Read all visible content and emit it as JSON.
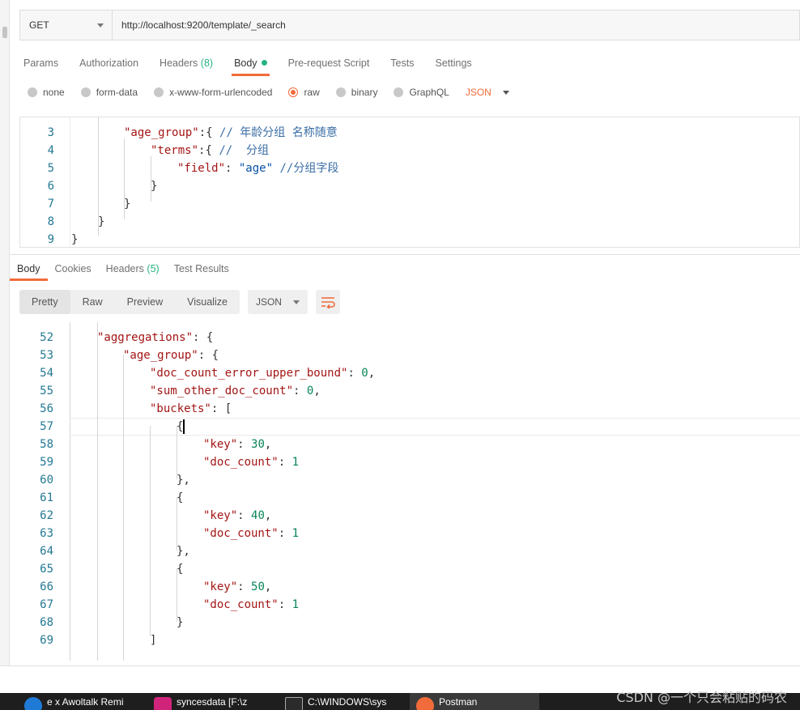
{
  "request": {
    "method": "GET",
    "url": "http://localhost:9200/template/_search"
  },
  "request_tabs": {
    "params": "Params",
    "authorization": "Authorization",
    "headers": "Headers",
    "headers_count": "(8)",
    "body": "Body",
    "pre_request": "Pre-request Script",
    "tests": "Tests",
    "settings": "Settings"
  },
  "body_types": {
    "none": "none",
    "form_data": "form-data",
    "urlencoded": "x-www-form-urlencoded",
    "raw": "raw",
    "binary": "binary",
    "graphql": "GraphQL",
    "format": "JSON"
  },
  "request_code": {
    "ln3": "3",
    "ln4": "4",
    "ln5": "5",
    "ln6": "6",
    "ln7": "7",
    "ln8": "8",
    "ln9": "9",
    "l3_key": "\"age_group\"",
    "l3_rest": ":{ ",
    "l3_comment": "// 年龄分组 名称随意",
    "l4_key": "\"terms\"",
    "l4_rest": ":{ ",
    "l4_comment": "//  分组",
    "l5_key": "\"field\"",
    "l5_colon": ": ",
    "l5_val": "\"age\"",
    "l5_comment": " //分组字段",
    "brace_close": "}"
  },
  "response_tabs": {
    "body": "Body",
    "cookies": "Cookies",
    "headers": "Headers",
    "headers_count": "(5)",
    "test_results": "Test Results"
  },
  "response_toolbar": {
    "pretty": "Pretty",
    "raw": "Raw",
    "preview": "Preview",
    "visualize": "Visualize",
    "format": "JSON"
  },
  "response_code": {
    "ln52": "52",
    "ln53": "53",
    "ln54": "54",
    "ln55": "55",
    "ln56": "56",
    "ln57": "57",
    "ln58": "58",
    "ln59": "59",
    "ln60": "60",
    "ln61": "61",
    "ln62": "62",
    "ln63": "63",
    "ln64": "64",
    "ln65": "65",
    "ln66": "66",
    "ln67": "67",
    "ln68": "68",
    "ln69": "69",
    "k_aggregations": "\"aggregations\"",
    "k_age_group": "\"age_group\"",
    "k_doc_count_error": "\"doc_count_error_upper_bound\"",
    "k_sum_other": "\"sum_other_doc_count\"",
    "k_buckets": "\"buckets\"",
    "k_key": "\"key\"",
    "k_doc_count": "\"doc_count\"",
    "v_zero": "0",
    "v_one": "1",
    "v_30": "30",
    "v_40": "40",
    "v_50": "50",
    "colon_brace": ": {",
    "colon_bracket": ": [",
    "colon": ": ",
    "comma": ",",
    "open_brace": "{",
    "close_brace": "}",
    "close_brace_comma": "},",
    "close_bracket": "]"
  },
  "taskbar": {
    "item1": "e x Awoltalk Remi",
    "item2": "syncesdata [F:\\z",
    "item3": "C:\\WINDOWS\\sys",
    "item4": "Postman"
  },
  "watermark": "CSDN @一个只会粘贴的码农",
  "colors": {
    "accent": "#f26b3a",
    "success": "#26b47f",
    "json_key": "#a31515",
    "json_string": "#0451a5",
    "json_number": "#098658"
  }
}
